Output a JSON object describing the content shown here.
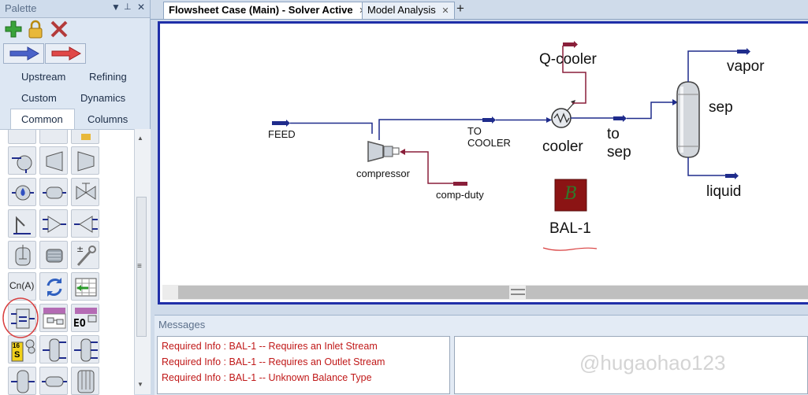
{
  "palette": {
    "title": "Palette",
    "controls": {
      "dropdown": "▼",
      "pin": "📌",
      "close": "✕"
    },
    "tabs": [
      {
        "label": "Upstream"
      },
      {
        "label": "Refining"
      },
      {
        "label": "Custom"
      },
      {
        "label": "Dynamics"
      },
      {
        "label": "Common",
        "selected": true
      },
      {
        "label": "Columns"
      }
    ],
    "icons": {
      "cn_a": "Cn(A)",
      "eo": "EO",
      "sixteen": "16",
      "s": "S"
    },
    "scroll_grip": "≡",
    "scroll_down": "▼",
    "scroll_up": "▲"
  },
  "document_tabs": [
    {
      "label": "Flowsheet Case (Main) - Solver Active",
      "active": true,
      "close": "✕"
    },
    {
      "label": "Model Analysis",
      "active": false,
      "close": "✕"
    }
  ],
  "add_tab": "+",
  "flowsheet": {
    "streams": {
      "feed": "FEED",
      "to_cooler_1": "TO",
      "to_cooler_2": "COOLER",
      "to_sep_1": "to",
      "to_sep_2": "sep",
      "vapor": "vapor",
      "liquid": "liquid",
      "q_cooler": "Q-cooler",
      "comp_duty": "comp-duty"
    },
    "units": {
      "compressor": "compressor",
      "cooler": "cooler",
      "sep": "sep",
      "balance": "BAL-1",
      "balance_glyph": "B"
    },
    "colors": {
      "material_stream": "#1f2c8c",
      "energy_stream": "#8a1f3a",
      "balance_fill": "#8b1414",
      "balance_glyph": "#2f7a2a"
    }
  },
  "messages": {
    "title": "Messages",
    "lines": [
      "Required Info  : BAL-1 -- Requires an Inlet Stream",
      "Required Info  : BAL-1 -- Requires an Outlet Stream",
      "Required Info  : BAL-1 -- Unknown Balance Type"
    ],
    "watermark": "@hugaohao123"
  }
}
